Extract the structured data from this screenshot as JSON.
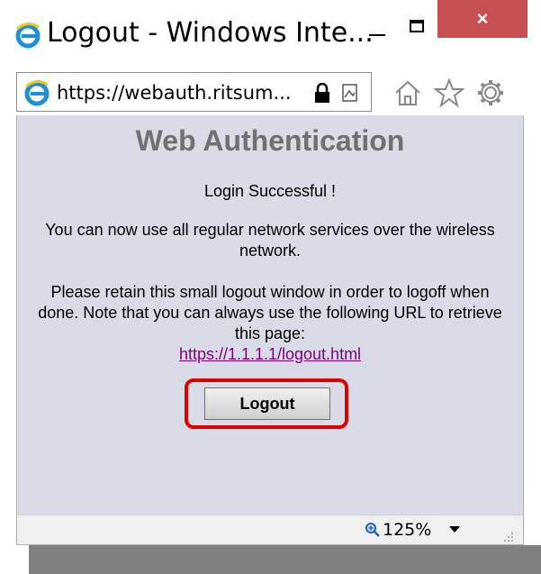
{
  "window": {
    "title": "Logout - Windows Inte...",
    "close_label": "×"
  },
  "address_bar": {
    "url_prefix": "https://webauth.",
    "url_host": "ritsum...",
    "icons": [
      "lock-icon",
      "compatibility-view-icon",
      "home-icon",
      "favorites-star-icon",
      "gear-icon"
    ]
  },
  "page": {
    "heading": "Web Authentication",
    "status": "Login Successful !",
    "info": "You can now use all regular network services over the wireless network.",
    "retain_note": "Please retain this small logout window in order to logoff when done. Note that you can always use the following URL to retrieve this page:",
    "logout_url": "https://1.1.1.1/logout.html",
    "logout_button": "Logout"
  },
  "status_bar": {
    "zoom": "125%"
  },
  "colors": {
    "content_bg": "#d9dce6",
    "heading": "#707070",
    "close_btn": "#c75050",
    "highlight": "#e00000",
    "link": "#800080"
  }
}
